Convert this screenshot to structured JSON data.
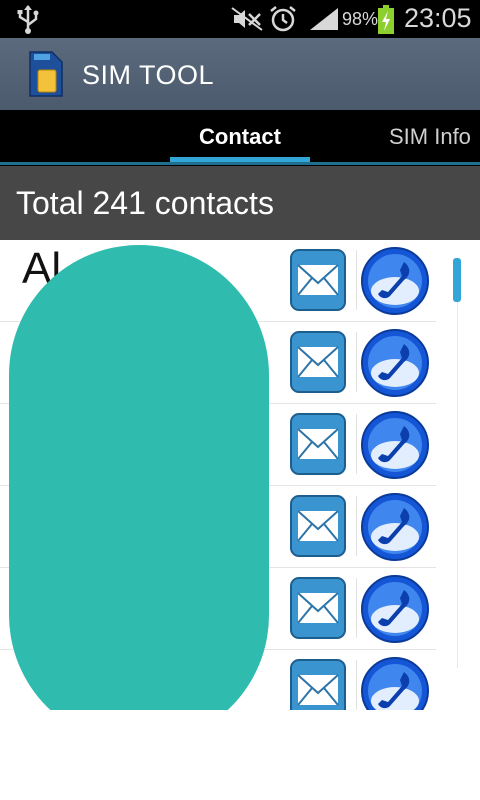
{
  "status_bar": {
    "battery_percent": "98%",
    "time": "23:05",
    "icons": [
      "usb-icon",
      "mute-icon",
      "alarm-icon",
      "signal-icon",
      "battery-charging-icon"
    ]
  },
  "app_bar": {
    "title": "SIM TOOL",
    "icon": "sim-card-icon"
  },
  "tabs": [
    {
      "label": "Contact",
      "selected": true
    },
    {
      "label": "SIM Info",
      "selected": false
    }
  ],
  "total": "Total 241 contacts",
  "contacts": [
    {
      "name": "Al"
    },
    {
      "name": ""
    },
    {
      "name": ""
    },
    {
      "name": ""
    },
    {
      "name": ""
    },
    {
      "name": ""
    }
  ],
  "row_icons": {
    "message": "envelope-icon",
    "call": "phone-icon"
  },
  "colors": {
    "accent": "#33a5d6",
    "app_bar": "#55667a",
    "total_bar": "#474747",
    "redaction": "#2fbbae"
  }
}
